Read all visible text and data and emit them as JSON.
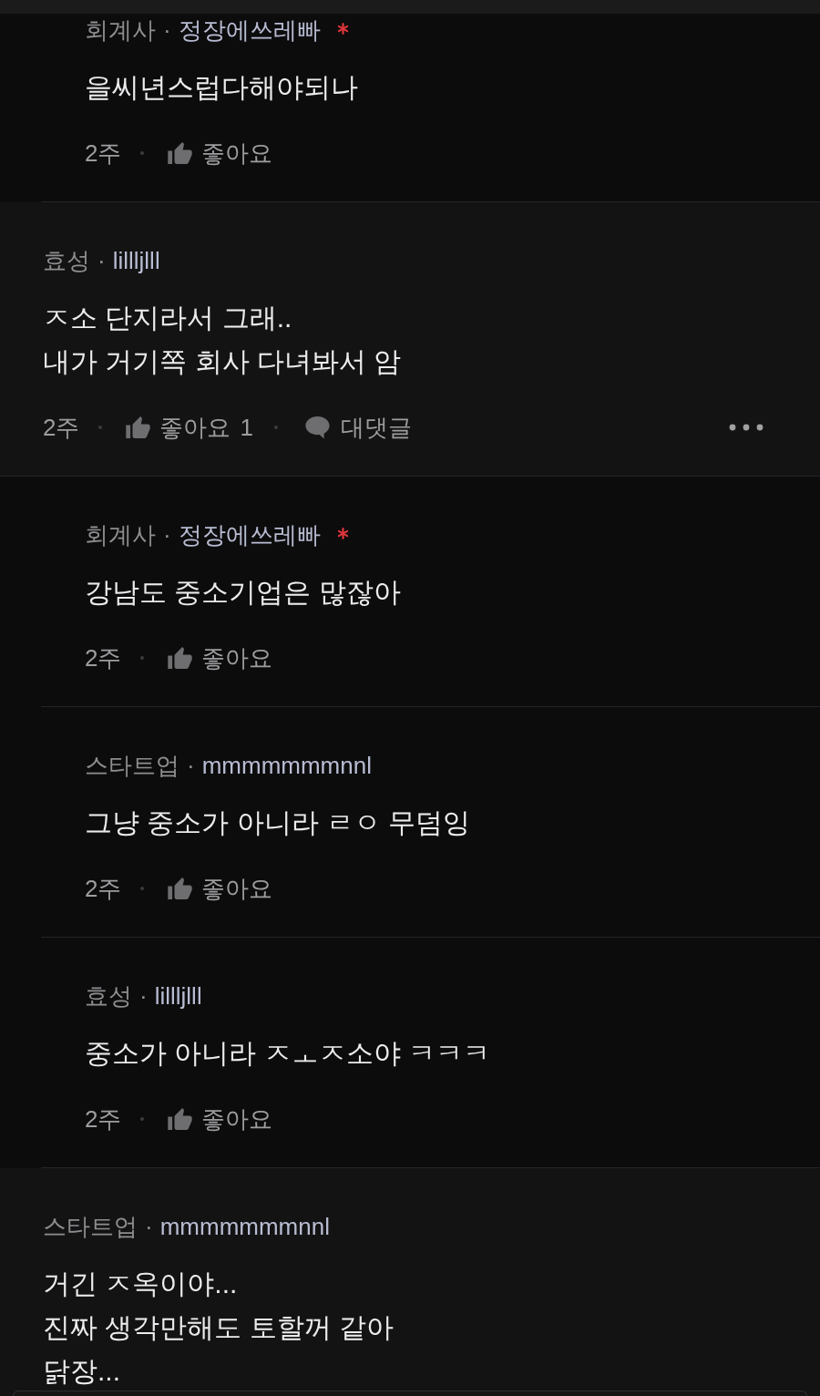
{
  "comments": [
    {
      "kind": "reply",
      "company": "회계사",
      "separator": "·",
      "nickname": "정장에쓰레빠",
      "author_mark": true,
      "lines": [
        "을씨년스럽다해야되나"
      ],
      "time": "2주",
      "like_label": "좋아요"
    },
    {
      "kind": "comment",
      "company": "효성",
      "separator": "·",
      "nickname": "lillljlll",
      "author_mark": false,
      "lines": [
        "ㅈ소 단지라서 그래..",
        "내가 거기쪽 회사 다녀봐서 암"
      ],
      "time": "2주",
      "like_label": "좋아요",
      "like_count": "1",
      "reply_label": "대댓글",
      "more_menu": true
    },
    {
      "kind": "reply",
      "company": "회계사",
      "separator": "·",
      "nickname": "정장에쓰레빠",
      "author_mark": true,
      "lines": [
        "강남도 중소기업은 많잖아"
      ],
      "time": "2주",
      "like_label": "좋아요"
    },
    {
      "kind": "reply",
      "company": "스타트업",
      "separator": "·",
      "nickname": "mmmmmmmnnl",
      "author_mark": false,
      "lines": [
        "그냥 중소가 아니라 ㄹㅇ 무덤잉"
      ],
      "time": "2주",
      "like_label": "좋아요"
    },
    {
      "kind": "reply",
      "company": "효성",
      "separator": "·",
      "nickname": "lillljlll",
      "author_mark": false,
      "lines": [
        "중소가 아니라 ㅈㅗㅈ소야 ㅋㅋㅋ"
      ],
      "time": "2주",
      "like_label": "좋아요"
    },
    {
      "kind": "comment",
      "company": "스타트업",
      "separator": "·",
      "nickname": "mmmmmmmnnl",
      "author_mark": false,
      "lines": [
        "거긴 ㅈ옥이야...",
        "진짜 생각만해도 토할꺼 같아",
        "닭장..."
      ]
    }
  ]
}
